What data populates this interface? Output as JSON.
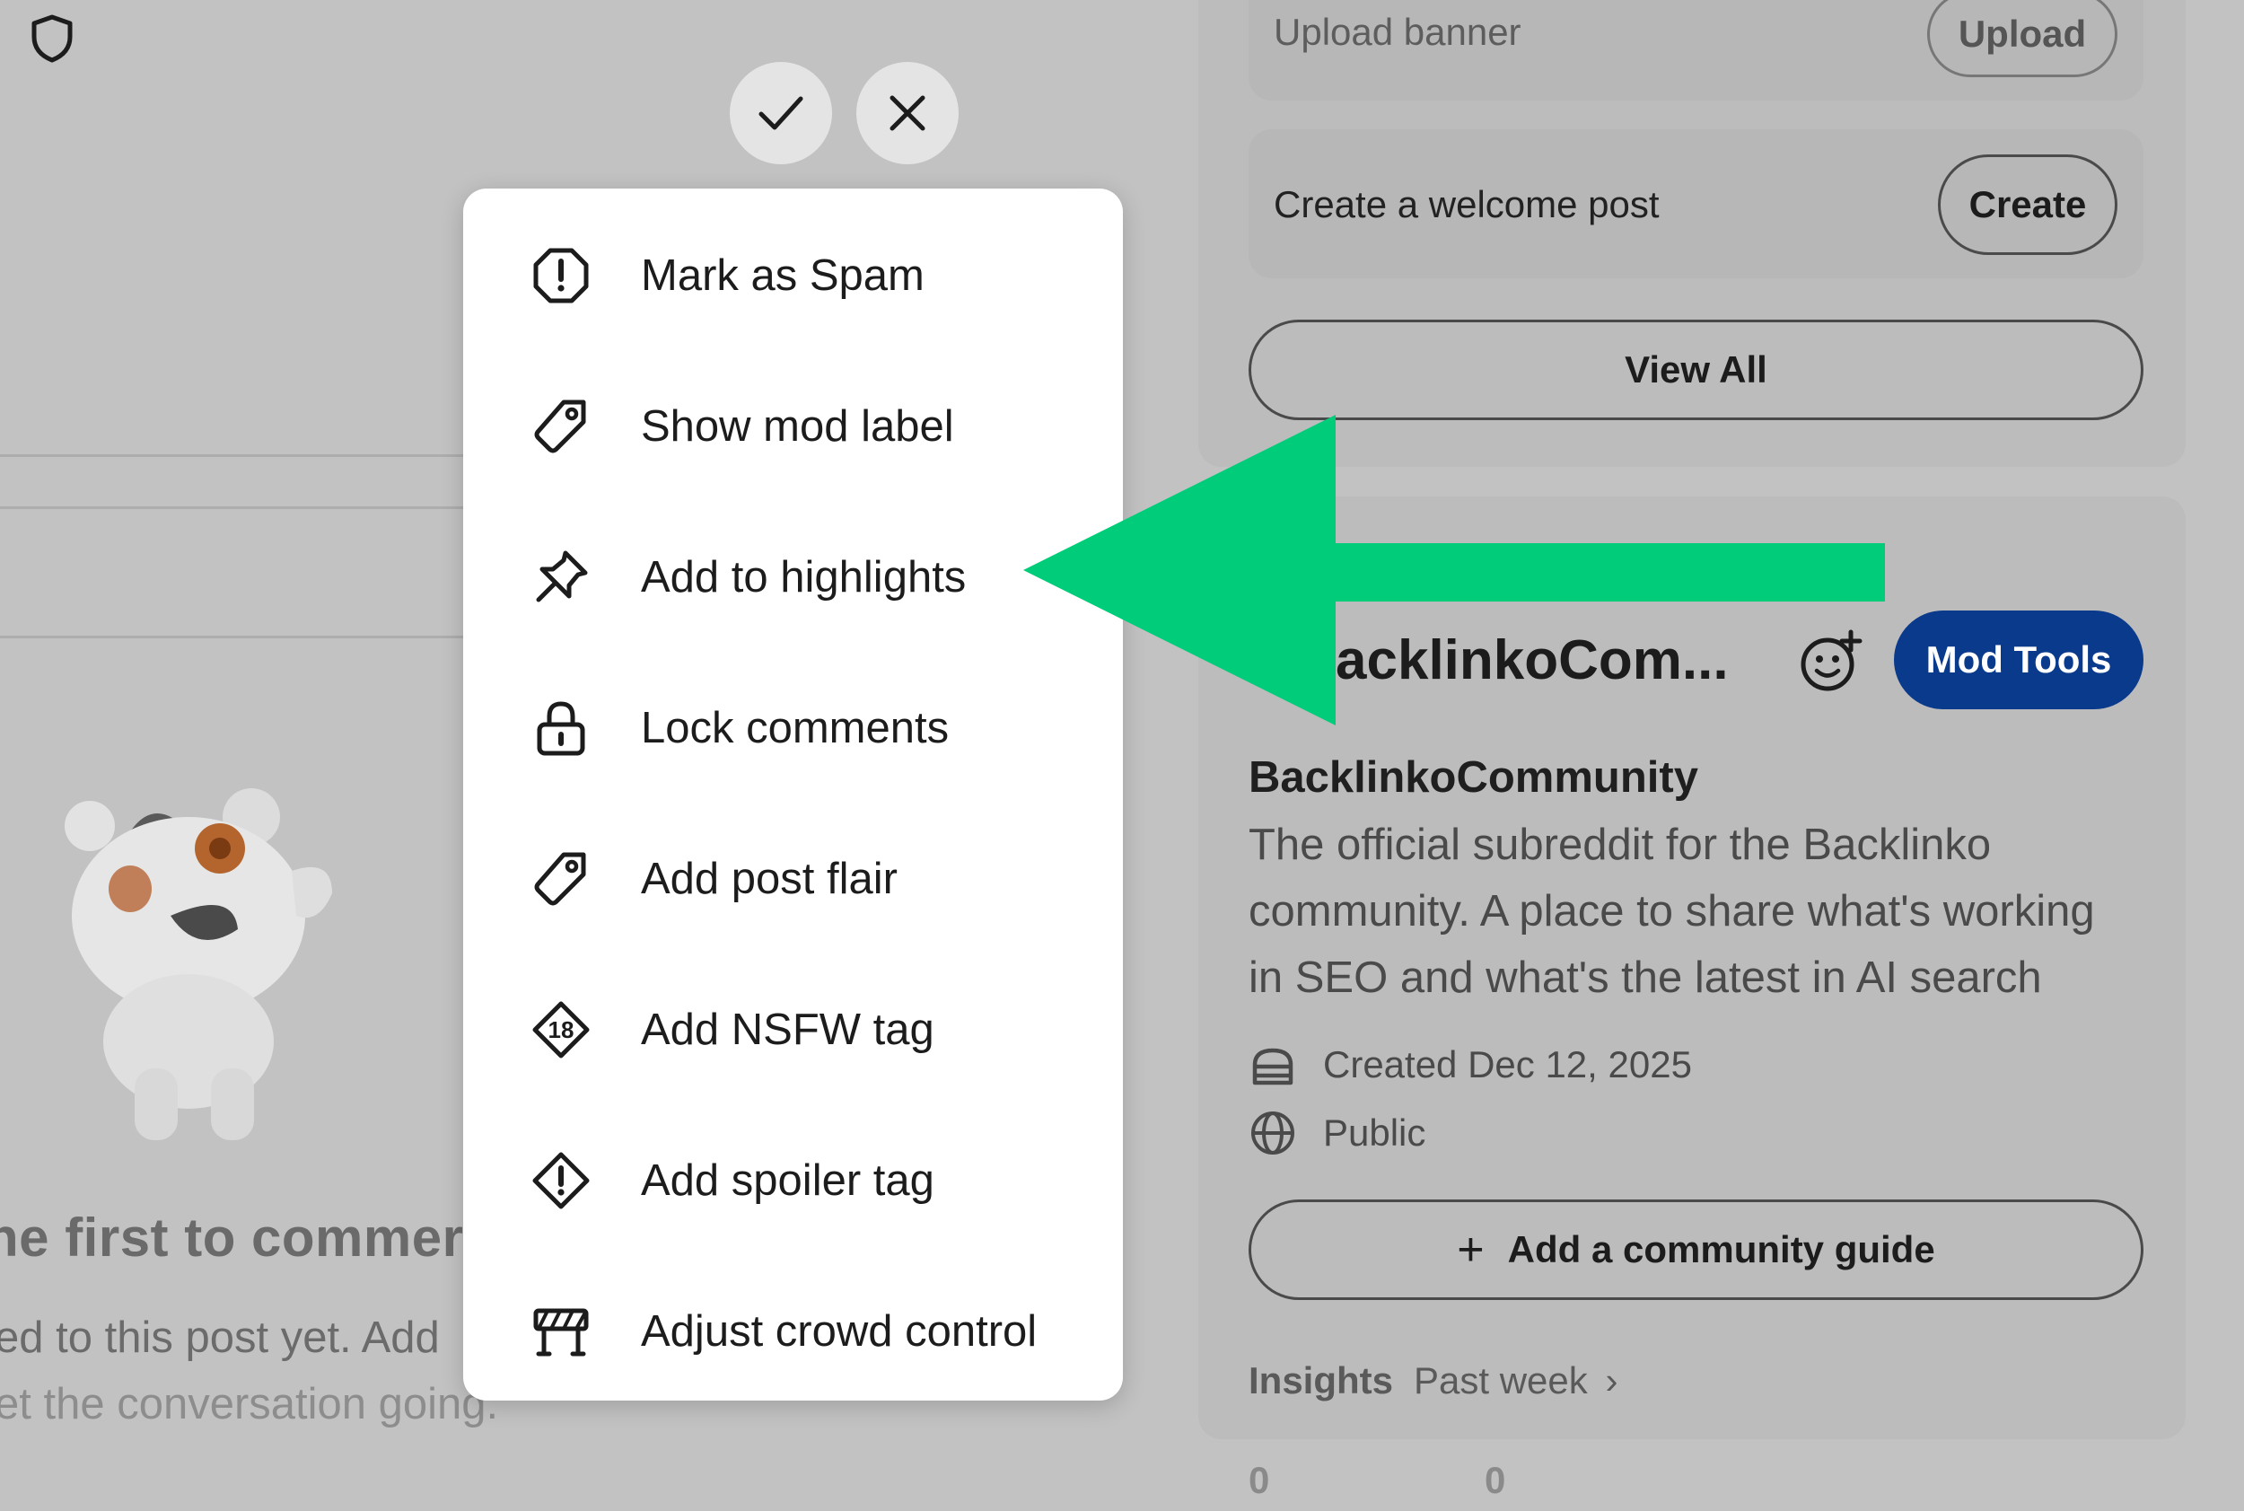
{
  "colors": {
    "background_overlay": "#c2c2c2",
    "mod_tools": "#0a3a8c",
    "annotation_arrow": "#00cc7a"
  },
  "toolbar": {
    "approve_icon": "check-icon",
    "remove_icon": "close-icon",
    "mod_shield_icon": "shield-icon"
  },
  "mod_menu": {
    "items": [
      {
        "label": "Mark as Spam",
        "icon": "alert-octagon-icon"
      },
      {
        "label": "Show mod label",
        "icon": "tag-icon"
      },
      {
        "label": "Add to highlights",
        "icon": "pin-icon"
      },
      {
        "label": "Lock comments",
        "icon": "lock-icon"
      },
      {
        "label": "Add post flair",
        "icon": "tag-icon"
      },
      {
        "label": "Add NSFW tag",
        "icon": "nsfw-18-icon"
      },
      {
        "label": "Add spoiler tag",
        "icon": "spoiler-diamond-icon"
      },
      {
        "label": "Adjust crowd control",
        "icon": "crowd-control-icon"
      }
    ]
  },
  "sidebar": {
    "upload_banner": {
      "label": "Upload banner",
      "button": "Upload"
    },
    "welcome_post": {
      "label": "Create a welcome post",
      "button": "Create"
    },
    "view_all": "View All",
    "community": {
      "header_name": "acklinkoCom...",
      "mod_tools": "Mod Tools",
      "name": "BacklinkoCommunity",
      "description_lines": [
        "The official subreddit for the Backlinko",
        "community. A place to share what's working",
        "in SEO and what's the latest in AI search"
      ],
      "created": "Created Dec 12, 2025",
      "visibility": "Public",
      "add_guide": "Add a community guide",
      "insights_label": "Insights",
      "insights_period": "Past week",
      "stats": [
        "0",
        "0"
      ]
    }
  },
  "comments_empty": {
    "title": "he first to commer",
    "line1": "ed to this post yet. Add",
    "line2": "et the conversation going."
  }
}
